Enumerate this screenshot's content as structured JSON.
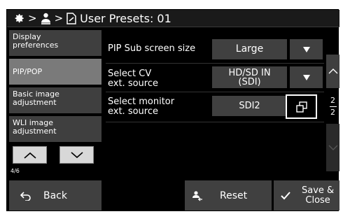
{
  "header": {
    "settings_icon": "gear-icon",
    "user_icon": "user-icon",
    "preset_icon": "preset-doc-icon",
    "separator": ">",
    "title": "User Presets: 01"
  },
  "menu": {
    "items": [
      {
        "label": "Display preferences",
        "line1": "Display",
        "line2": "preferences",
        "active": false
      },
      {
        "label": "PIP/POP",
        "active": true
      },
      {
        "label": "Basic image adjustment",
        "line1": "Basic image",
        "line2": "adjustment",
        "active": false
      },
      {
        "label": "WLI image adjustment",
        "line1": "WLI image",
        "line2": "adjustment",
        "active": false
      }
    ],
    "page": "4/6"
  },
  "settings": {
    "pip_sub_size": {
      "label": "PIP Sub screen size",
      "value": "Large"
    },
    "cv_source": {
      "label_line1": "Select CV",
      "label_line2": "ext. source",
      "value_line1": "HD/SD IN",
      "value_line2": "(SDI)"
    },
    "monitor_source": {
      "label_line1": "Select monitor",
      "label_line2": "ext. source",
      "value": "SDI2"
    }
  },
  "scroll": {
    "current": "2",
    "total": "2"
  },
  "footer": {
    "back_label": "Back",
    "reset_label": "Reset",
    "save_line1": "Save &",
    "save_line2": "Close"
  },
  "colors": {
    "background": "#000000",
    "button": "#404040",
    "menu_item": "#3f3f3f",
    "menu_active": "#7a7a7a",
    "text": "#ffffff"
  }
}
